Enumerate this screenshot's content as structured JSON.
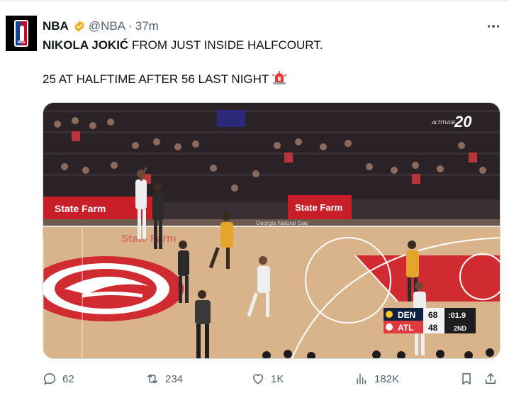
{
  "tweet": {
    "author_name": "NBA",
    "handle": "@NBA",
    "separator": "·",
    "time": "37m",
    "line1_bold": "NIKOLA JOKIĆ",
    "line1_rest": " FROM JUST INSIDE HALFCOURT.",
    "line2": "25 AT HALFTIME AFTER 56 LAST NIGHT",
    "avatar_text": "NBA"
  },
  "video": {
    "banners": [
      "State Farm",
      "State Farm",
      "State Farm",
      "State Farm"
    ],
    "scoreboard": {
      "team1": "DEN",
      "score1": "68",
      "team2": "ATL",
      "score2": "48",
      "clock": ":01.9",
      "period": "2ND"
    },
    "bug": "20",
    "bug_small": "ALTITUDE",
    "arena_sign": "Georgia Natural Gas"
  },
  "actions": {
    "replies": "62",
    "reposts": "234",
    "likes": "1K",
    "views": "182K"
  },
  "colors": {
    "verified": "#e8b31e",
    "hawks_red": "#e03a3e",
    "court": "#d9b48a"
  }
}
